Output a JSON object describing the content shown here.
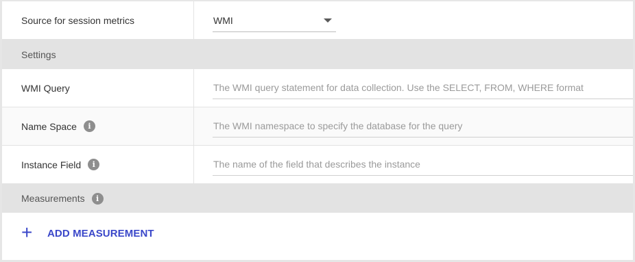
{
  "session_metrics": {
    "label": "Source for session metrics",
    "selected": "WMI"
  },
  "settings_section": {
    "label": "Settings"
  },
  "wmi_query": {
    "label": "WMI Query",
    "placeholder": "The WMI query statement for data collection. Use the SELECT, FROM, WHERE format"
  },
  "name_space": {
    "label": "Name Space",
    "placeholder": "The WMI namespace to specify the database for the query",
    "icon": "info-icon"
  },
  "instance_field": {
    "label": "Instance Field",
    "placeholder": "The name of the field that describes the instance",
    "icon": "info-icon"
  },
  "measurements_section": {
    "label": "Measurements",
    "icon": "info-icon"
  },
  "add_measurement": {
    "label": "ADD MEASUREMENT",
    "icon": "plus-icon"
  },
  "colors": {
    "accent": "#3a47c9",
    "section_bg": "#e3e3e3"
  }
}
